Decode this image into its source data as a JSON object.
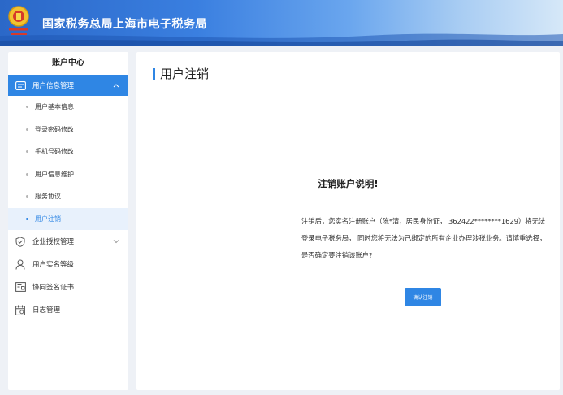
{
  "header": {
    "site_title": "国家税务总局上海市电子税务局",
    "logo_icon": "tax-emblem-icon"
  },
  "sidebar": {
    "title": "账户中心",
    "groups": [
      {
        "label": "用户信息管理",
        "icon": "user-card-icon",
        "expanded": true,
        "items": [
          {
            "label": "用户基本信息"
          },
          {
            "label": "登录密码修改"
          },
          {
            "label": "手机号码修改"
          },
          {
            "label": "用户信息维护"
          },
          {
            "label": "服务协议"
          },
          {
            "label": "用户注销",
            "active": true
          }
        ]
      },
      {
        "label": "企业授权管理",
        "icon": "shield-check-icon",
        "expanded": false
      },
      {
        "label": "用户实名等级",
        "icon": "user-icon"
      },
      {
        "label": "协同签名证书",
        "icon": "certificate-icon"
      },
      {
        "label": "日志管理",
        "icon": "calendar-log-icon"
      }
    ]
  },
  "main": {
    "title": "用户注销",
    "notice_title": "注销账户说明!",
    "notice_text": "注销后，您实名注册账户（陈*清，居民身份证，  362422********1629）将无法登录电子税务局，  同时您将无法为已绑定的所有企业办理涉税业务。请慎重选择，是否确定要注销该账户?",
    "confirm_button": "确认注销"
  },
  "colors": {
    "accent": "#2f86e4",
    "header_start": "#2b68c8",
    "background": "#eef1f6"
  }
}
